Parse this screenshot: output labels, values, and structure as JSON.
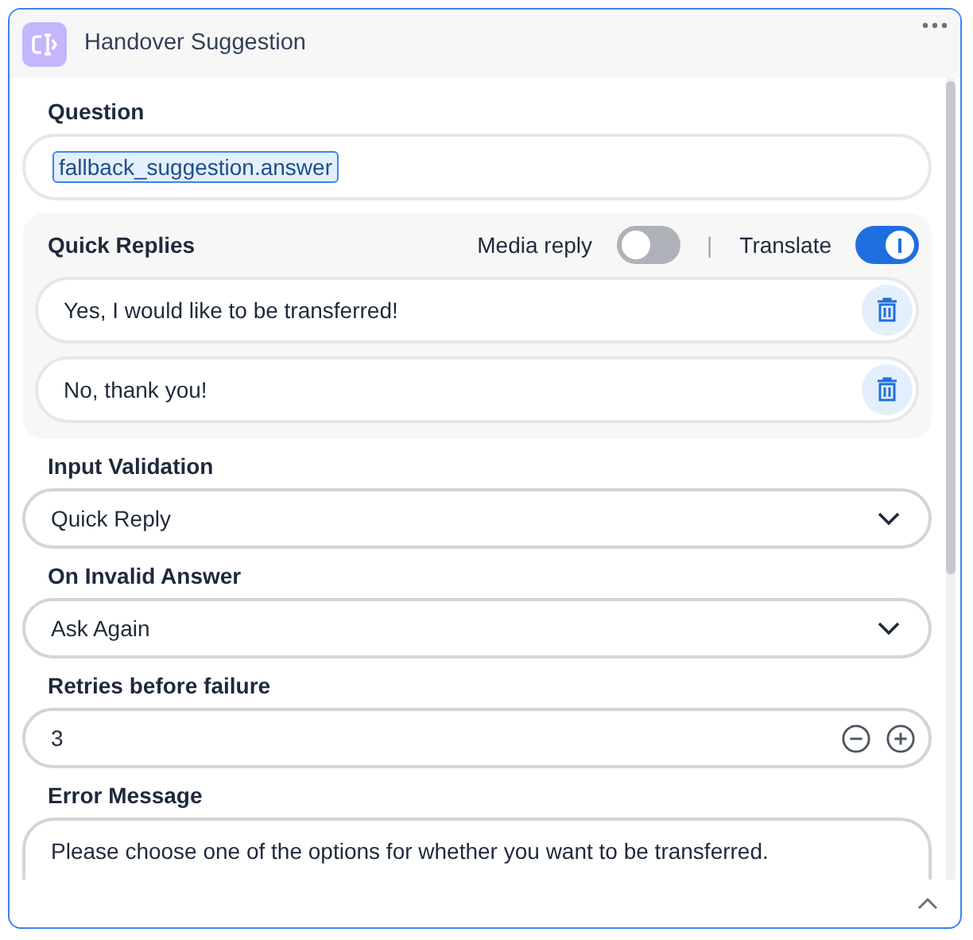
{
  "header": {
    "title": "Handover Suggestion"
  },
  "question": {
    "label": "Question",
    "token": "fallback_suggestion.answer"
  },
  "quick_replies": {
    "label": "Quick Replies",
    "toggles": [
      {
        "label": "Media reply",
        "on": false
      },
      {
        "label": "Translate",
        "on": true
      }
    ],
    "separator": "|",
    "items": [
      {
        "text": "Yes, I would like to be transferred!"
      },
      {
        "text": "No, thank you!"
      }
    ]
  },
  "input_validation": {
    "label": "Input Validation",
    "value": "Quick Reply"
  },
  "on_invalid_answer": {
    "label": "On Invalid Answer",
    "value": "Ask Again"
  },
  "retries": {
    "label": "Retries before failure",
    "value": "3"
  },
  "error_message": {
    "label": "Error Message",
    "value": "Please choose one of the options for whether you want to be transferred."
  }
}
